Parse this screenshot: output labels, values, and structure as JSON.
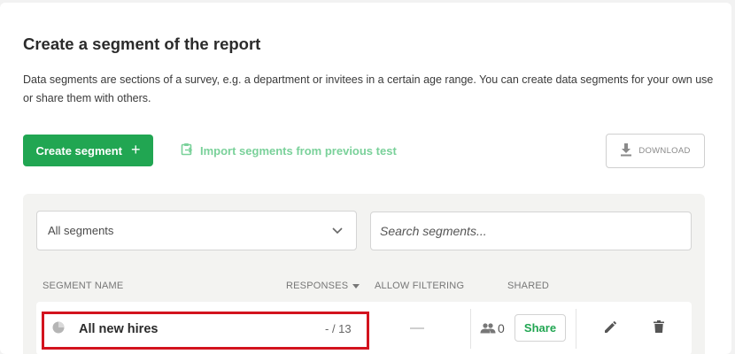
{
  "header": {
    "title": "Create a segment of the report",
    "description": "Data segments are sections of a survey, e.g. a department or invitees in a certain age range. You can create data segments for your own use or share them with others."
  },
  "actions": {
    "create_label": "Create segment",
    "create_icon": "plus-icon",
    "import_label": "Import segments from previous test",
    "import_icon": "clipboard-import-icon",
    "download_label": "DOWNLOAD",
    "download_icon": "download-icon"
  },
  "filters": {
    "select_value": "All segments",
    "search_placeholder": "Search segments..."
  },
  "table": {
    "columns": {
      "name": "SEGMENT NAME",
      "responses": "RESPONSES",
      "allow_filtering": "ALLOW FILTERING",
      "shared": "SHARED"
    },
    "rows": [
      {
        "name": "All new hires",
        "responses": "- / 13",
        "allow_filtering": "—",
        "shared_count": "0",
        "share_label": "Share"
      }
    ]
  },
  "colors": {
    "primary_green": "#21a652",
    "light_green": "#7ad19a",
    "highlight_red": "#d3131e"
  }
}
